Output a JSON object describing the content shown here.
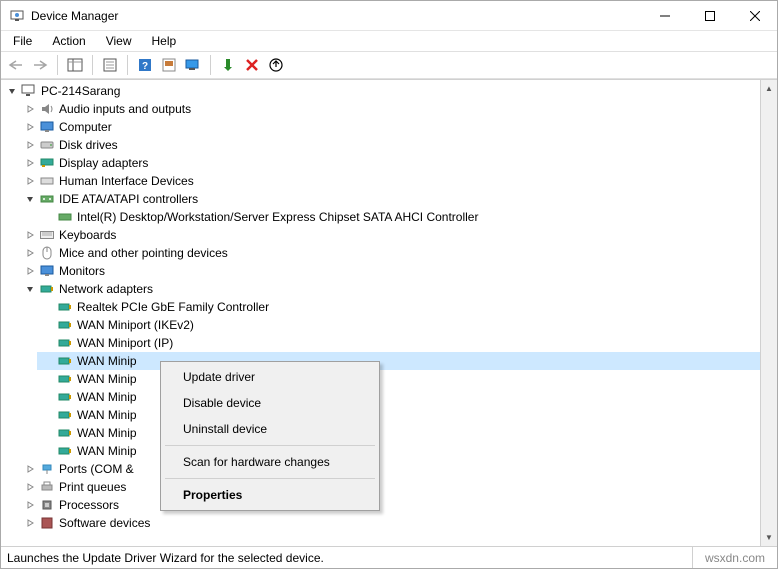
{
  "window": {
    "title": "Device Manager"
  },
  "menu": {
    "file": "File",
    "action": "Action",
    "view": "View",
    "help": "Help"
  },
  "tree": {
    "root": "PC-214Sarang",
    "audio": "Audio inputs and outputs",
    "computer": "Computer",
    "disk": "Disk drives",
    "display": "Display adapters",
    "hid": "Human Interface Devices",
    "ide": "IDE ATA/ATAPI controllers",
    "ide_child": "Intel(R) Desktop/Workstation/Server Express Chipset SATA AHCI Controller",
    "keyboards": "Keyboards",
    "mice": "Mice and other pointing devices",
    "monitors": "Monitors",
    "network": "Network adapters",
    "net_realtek": "Realtek PCIe GbE Family Controller",
    "net_ikev2": "WAN Miniport (IKEv2)",
    "net_ip": "WAN Miniport (IP)",
    "net_selected": "WAN Minip",
    "net_wm1": "WAN Minip",
    "net_wm2": "WAN Minip",
    "net_wm3": "WAN Minip",
    "net_wm4": "WAN Minip",
    "net_wm5": "WAN Minip",
    "ports": "Ports (COM &",
    "printq": "Print queues",
    "processors": "Processors",
    "software": "Software devices"
  },
  "contextmenu": {
    "update": "Update driver",
    "disable": "Disable device",
    "uninstall": "Uninstall device",
    "scan": "Scan for hardware changes",
    "properties": "Properties"
  },
  "status": {
    "text": "Launches the Update Driver Wizard for the selected device.",
    "brand": "wsxdn.com"
  }
}
